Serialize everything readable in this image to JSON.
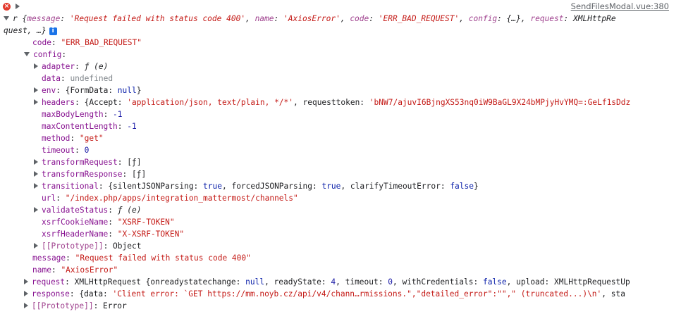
{
  "source_link": "SendFilesModal.vue:380",
  "error": {
    "summary_prefix": "r {",
    "summary_fields": [
      {
        "k": "message",
        "v": "'Request failed with status code 400'"
      },
      {
        "k": "name",
        "v": "'AxiosError'"
      },
      {
        "k": "code",
        "v": "'ERR_BAD_REQUEST'"
      },
      {
        "k": "config",
        "v": "{…}"
      },
      {
        "k": "request",
        "v": "XMLHttpRe"
      }
    ],
    "summary_line2": "quest, …}",
    "info_icon": "i"
  },
  "code": {
    "key": "code",
    "value": "\"ERR_BAD_REQUEST\""
  },
  "config": {
    "key": "config",
    "adapter": {
      "key": "adapter",
      "value": "ƒ (e)"
    },
    "data": {
      "key": "data",
      "value": "undefined"
    },
    "env": {
      "key": "env",
      "value_a": "{FormData: ",
      "value_b": "null",
      "value_c": "}"
    },
    "headers": {
      "key": "headers",
      "value_a": "{Accept: ",
      "value_b": "'application/json, text/plain, */*'",
      "value_c": ", requesttoken: ",
      "value_d": "'bNW7/ajuvI6BjngXS53nq0iW9BaGL9X24bMPjyHvYMQ=:GeLf1sDdz"
    },
    "maxBodyLength": {
      "key": "maxBodyLength",
      "value": "-1"
    },
    "maxContentLength": {
      "key": "maxContentLength",
      "value": "-1"
    },
    "method": {
      "key": "method",
      "value": "\"get\""
    },
    "timeout": {
      "key": "timeout",
      "value": "0"
    },
    "transformRequest": {
      "key": "transformRequest",
      "value": "[ƒ]"
    },
    "transformResponse": {
      "key": "transformResponse",
      "value": "[ƒ]"
    },
    "transitional": {
      "key": "transitional",
      "a": "{silentJSONParsing: ",
      "b": "true",
      "c": ", forcedJSONParsing: ",
      "d": "true",
      "e": ", clarifyTimeoutError: ",
      "f": "false",
      "g": "}"
    },
    "url": {
      "key": "url",
      "value": "\"/index.php/apps/integration_mattermost/channels\""
    },
    "validateStatus": {
      "key": "validateStatus",
      "value": "ƒ (e)"
    },
    "xsrfCookieName": {
      "key": "xsrfCookieName",
      "value": "\"XSRF-TOKEN\""
    },
    "xsrfHeaderName": {
      "key": "xsrfHeaderName",
      "value": "\"X-XSRF-TOKEN\""
    },
    "prototype": {
      "key": "[[Prototype]]",
      "value": "Object"
    }
  },
  "message": {
    "key": "message",
    "value": "\"Request failed with status code 400\""
  },
  "name": {
    "key": "name",
    "value": "\"AxiosError\""
  },
  "request": {
    "key": "request",
    "a": "XMLHttpRequest {onreadystatechange: ",
    "b": "null",
    "c": ", readyState: ",
    "d": "4",
    "e": ", timeout: ",
    "f": "0",
    "g": ", withCredentials: ",
    "h": "false",
    "i": ", upload: XMLHttpRequestUp"
  },
  "response": {
    "key": "response",
    "a": "{data: ",
    "b": "'Client error: `GET https://mm.noyb.cz/api/v4/chann…rmissions.\",\"detailed_error\":\"\",\" (truncated...)\\n'",
    "c": ", sta"
  },
  "prototype_root": {
    "key": "[[Prototype]]",
    "value": "Error"
  }
}
